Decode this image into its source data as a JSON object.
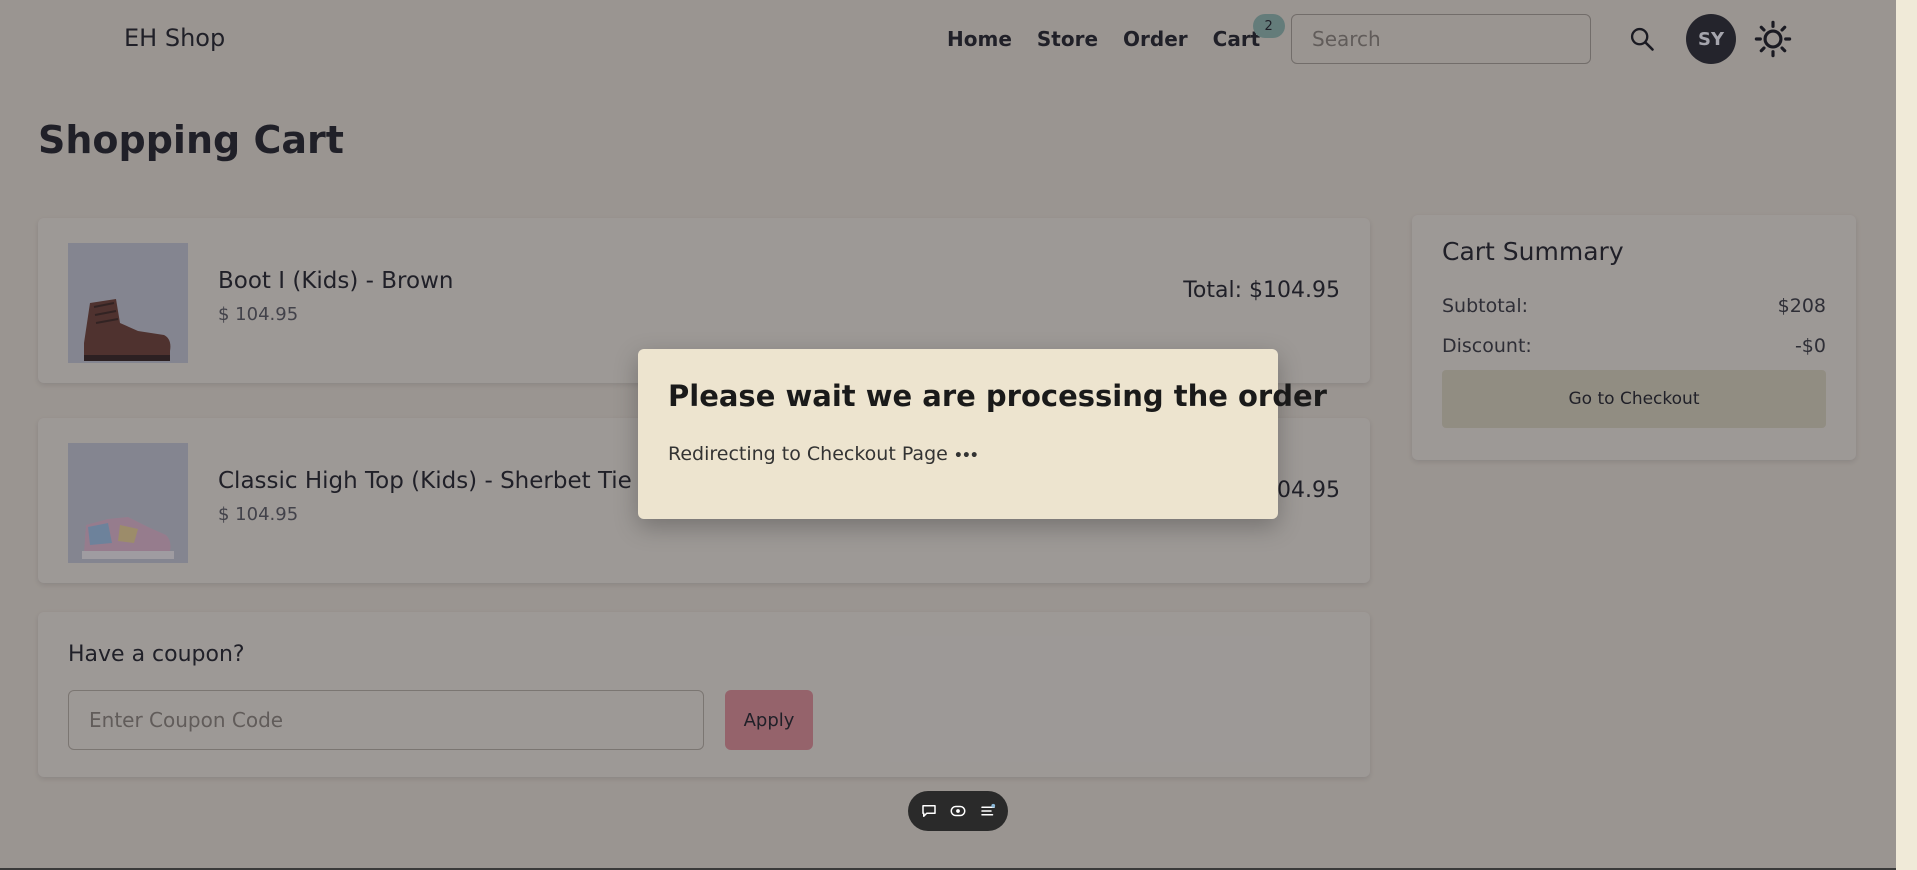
{
  "header": {
    "brand": "EH Shop",
    "nav": {
      "home": "Home",
      "store": "Store",
      "order": "Order",
      "cart": "Cart"
    },
    "cart_count": "2",
    "search_placeholder": "Search",
    "avatar_initials": "SY"
  },
  "page_title": "Shopping Cart",
  "cart_items": [
    {
      "name": "Boot I (Kids) - Brown",
      "price": "$ 104.95",
      "total": "Total: $104.95"
    },
    {
      "name": "Classic High Top (Kids) - Sherbet Tie Dye",
      "price": "$ 104.95",
      "total": "104.95"
    }
  ],
  "coupon": {
    "title": "Have a coupon?",
    "placeholder": "Enter Coupon Code",
    "apply_label": "Apply"
  },
  "summary": {
    "title": "Cart Summary",
    "subtotal_label": "Subtotal:",
    "subtotal_value": "$208",
    "discount_label": "Discount:",
    "discount_value": "-$0",
    "checkout_label": "Go to Checkout"
  },
  "modal": {
    "title": "Please wait we are processing the order",
    "message": "Redirecting to Checkout Page",
    "dots": "•••"
  },
  "toolbar": {
    "icons": [
      "comment-icon",
      "eye-icon",
      "settings-list-icon"
    ]
  },
  "colors": {
    "background": "#ede4cf",
    "badge": "#8fb8a8",
    "apply_button": "#e48d8e",
    "checkout_button": "#ddd6b6",
    "avatar": "#222222"
  }
}
